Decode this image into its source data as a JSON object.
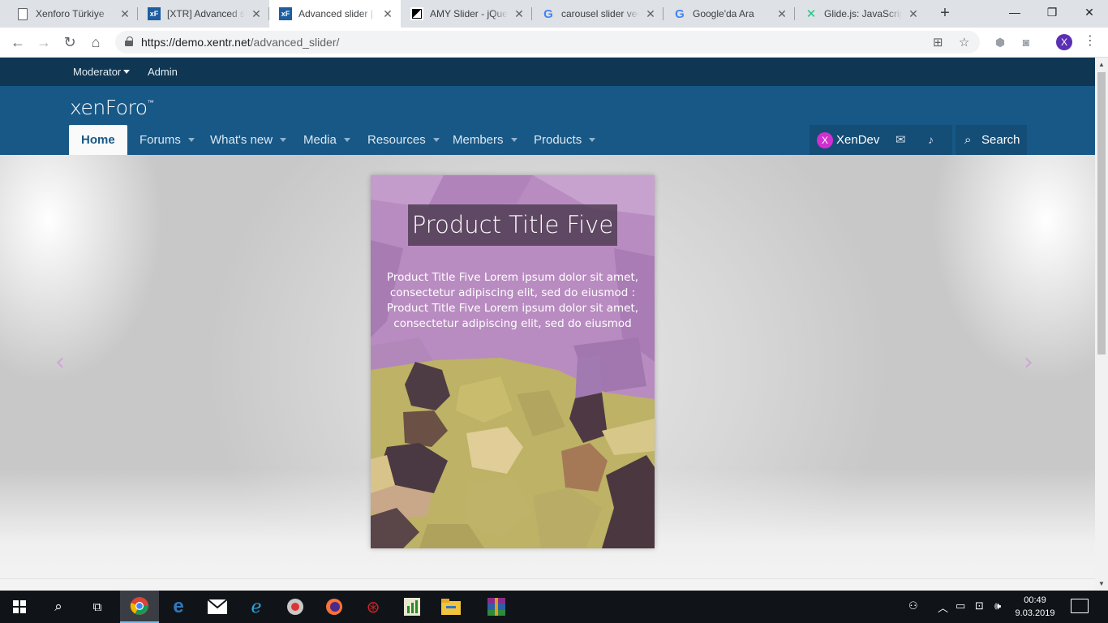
{
  "browser": {
    "tabs": [
      {
        "title": "Xenforo Türkiye",
        "icon": "document-icon"
      },
      {
        "title": "[XTR] Advanced sl",
        "icon": "xenforo-icon"
      },
      {
        "title": "Advanced slider | X",
        "icon": "xenforo-icon"
      },
      {
        "title": "AMY Slider - jQue",
        "icon": "amy-icon"
      },
      {
        "title": "carousel slider vec",
        "icon": "google-icon"
      },
      {
        "title": "Google'da Ara",
        "icon": "google-icon"
      },
      {
        "title": "Glide.js: JavaScript",
        "icon": "glide-icon"
      }
    ],
    "url_host": "https://demo.xentr.net",
    "url_path": "/advanced_slider/",
    "profile_initial": "X"
  },
  "staffbar": {
    "moderator": "Moderator",
    "admin": "Admin"
  },
  "header": {
    "logo": "xenForo",
    "logo_tm": "™",
    "nav": [
      "Home",
      "Forums",
      "What's new",
      "Media",
      "Resources",
      "Members",
      "Products"
    ],
    "user_initial": "X",
    "username": "XenDev",
    "search": "Search"
  },
  "slider": {
    "title": "Product Title Five",
    "description": "Product Title Five Lorem ipsum dolor sit amet, consectetur adipiscing elit, sed do eiusmod : Product Title Five Lorem ipsum dolor sit amet, consectetur adipiscing elit, sed do eiusmod",
    "prev": "‹",
    "next": "›"
  },
  "taskbar": {
    "time": "00:49",
    "date": "9.03.2019"
  },
  "colors": {
    "staffbar": "#0f3652",
    "header": "#185886",
    "slide_purple": "#b88ac0",
    "slide_olive": "#c4b96a",
    "arrow": "#cfa6d6"
  }
}
